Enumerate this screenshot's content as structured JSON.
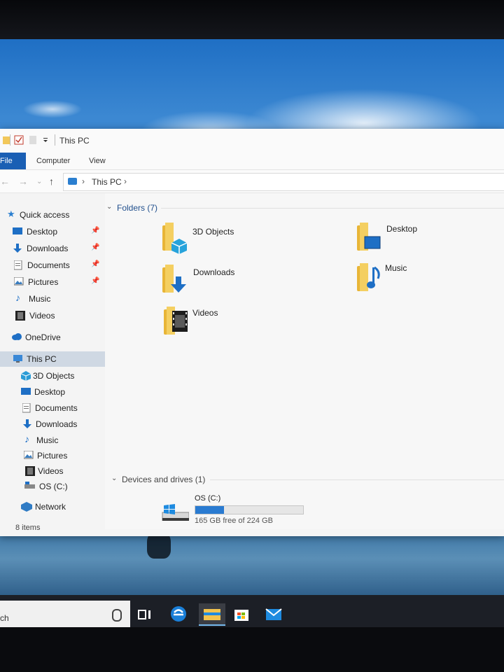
{
  "window": {
    "title": "This PC",
    "ribbon_tabs": [
      "File",
      "Computer",
      "View"
    ],
    "address": {
      "crumb": "This PC"
    }
  },
  "sidebar": {
    "quick_access": "Quick access",
    "pinned": [
      "Desktop",
      "Downloads",
      "Documents",
      "Pictures"
    ],
    "recent": [
      "Music",
      "Videos"
    ],
    "onedrive": "OneDrive",
    "this_pc": "This PC",
    "this_pc_items": [
      "3D Objects",
      "Desktop",
      "Documents",
      "Downloads",
      "Music",
      "Pictures",
      "Videos",
      "OS (C:)"
    ],
    "network": "Network"
  },
  "content": {
    "folders_header": "Folders (7)",
    "folders": [
      "3D Objects",
      "Desktop",
      "Downloads",
      "Music",
      "Videos"
    ],
    "devices_header": "Devices and drives (1)",
    "drive": {
      "name": "OS (C:)",
      "free_text": "165 GB free of 224 GB",
      "used_fraction": 0.263
    }
  },
  "status": {
    "items": "8 items"
  },
  "taskbar": {
    "search_partial": "ch"
  },
  "colors": {
    "accent": "#1a5fb4",
    "folder_yellow": "#f4cf61",
    "drive_bar": "#2a7bd1"
  }
}
